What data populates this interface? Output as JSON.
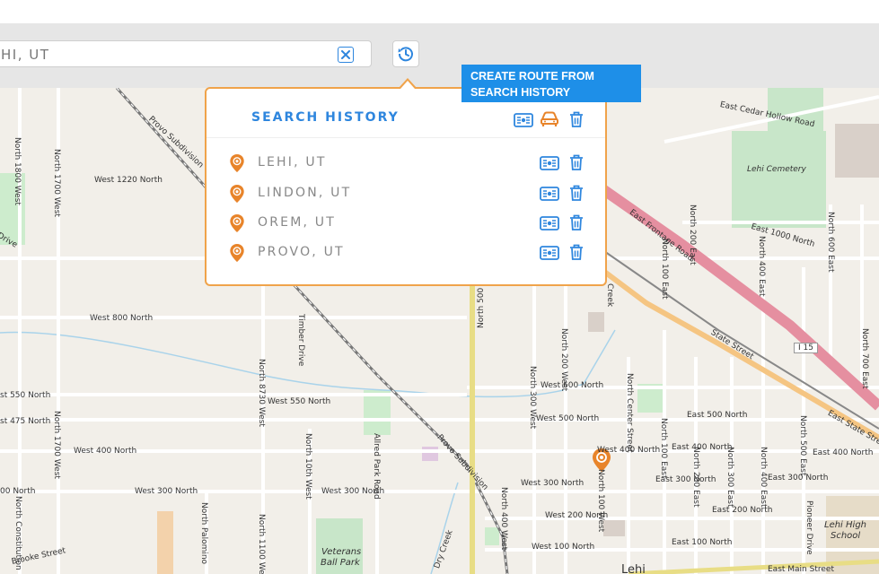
{
  "search": {
    "value": "HI, UT"
  },
  "popup": {
    "title": "SEARCH HISTORY",
    "items": [
      {
        "label": "LEHI, UT"
      },
      {
        "label": "LINDON, UT"
      },
      {
        "label": "OREM, UT"
      },
      {
        "label": "PROVO, UT"
      }
    ]
  },
  "tooltip": {
    "line1": "CREATE ROUTE FROM",
    "line2": "SEARCH HISTORY"
  },
  "colors": {
    "accent": "#2e86de",
    "pin": "#e8842a",
    "popup_border": "#f0a34a",
    "tooltip_bg": "#1e8fe8"
  },
  "icons": [
    "clear-icon",
    "history-icon",
    "route-icon",
    "car-icon",
    "trash-icon",
    "location-pin-icon"
  ],
  "map_labels": {
    "provo_subdivision_top": "Provo Subdivision",
    "north_1800_west": "North 1800 West",
    "north_1700_west_top": "North 1700 West",
    "west_1220_north": "West 1220 North",
    "drive": "Drive",
    "west_800_north": "West 800 North",
    "timber_drive": "Timber Drive",
    "north_8730_west": "North 8730 West",
    "west_550_north_left": "st 550 North",
    "west_550_north": "West 550 North",
    "west_475_north": "st 475 North",
    "north_1700_west": "North 1700 West",
    "west_400_north": "West 400 North",
    "north_10th_west": "North 10th West",
    "allred_park_road": "Allred Park Road",
    "provo_subdivision": "Provo Subdivision",
    "west_300_north_left": "00 North",
    "west_300_north": "West 300 North",
    "west_300_north_2": "West 300 North",
    "north_500_west": "North 500 West",
    "north_300_west": "North 300 West",
    "north_200_west": "North 200 West",
    "north_400_west": "North 400 West",
    "west_600_north": "West 600 North",
    "west_500_north": "West 500 North",
    "west_400_north_2": "West 400 North",
    "west_300_north_3": "West 300 North",
    "west_200_north": "West 200 North",
    "west_100_north": "West 100 North",
    "north_100_west": "North 100 West",
    "north_center_street": "North Center Street",
    "north_100_east": "North 100 East",
    "north_200_east": "North 200 East",
    "north_300_east": "North 300 East",
    "north_400_east": "North 400 East",
    "north_500_east": "North 500 East",
    "east_500_north": "East 500 North",
    "east_400_north": "East 400 North",
    "east_400_north_2": "East 400 North",
    "east_300_north": "East 300 North",
    "east_300_north_2": "East 300 North",
    "east_200_north": "East 200 North",
    "east_100_north": "East 100 North",
    "east_main_street": "East Main Street",
    "lehi": "Lehi",
    "state_street": "State Street",
    "east_state_street": "East State Stre",
    "i15": "I 15",
    "east_frontage_road": "East Frontage Road",
    "east_1000_north": "East 1000 North",
    "east_cedar_hollow_road": "East Cedar Hollow Road",
    "lehi_cemetery": "Lehi Cemetery",
    "north_600_east": "North 600 East",
    "north_700_east": "North 700 East",
    "north_400_east_top": "North 400 East",
    "north_100_east_top": "North 100 East",
    "north_200_east_top": "North 200 East",
    "lehi_high_school_1": "Lehi High",
    "lehi_high_school_2": "School",
    "pioneer_drive": "Pioneer Drive",
    "veterans_1": "Veterans",
    "veterans_2": "Ball Park",
    "dry_creek": "Dry Creek",
    "creek": "Creek",
    "brooke_street": "Brooke Street",
    "north_constitution": "North Constitution",
    "north_1100_west": "North 1100 West",
    "north_palomino": "North Palomino",
    "west_300_north_s": "West 300 North",
    "north_500_west_2": "North 500 West"
  }
}
